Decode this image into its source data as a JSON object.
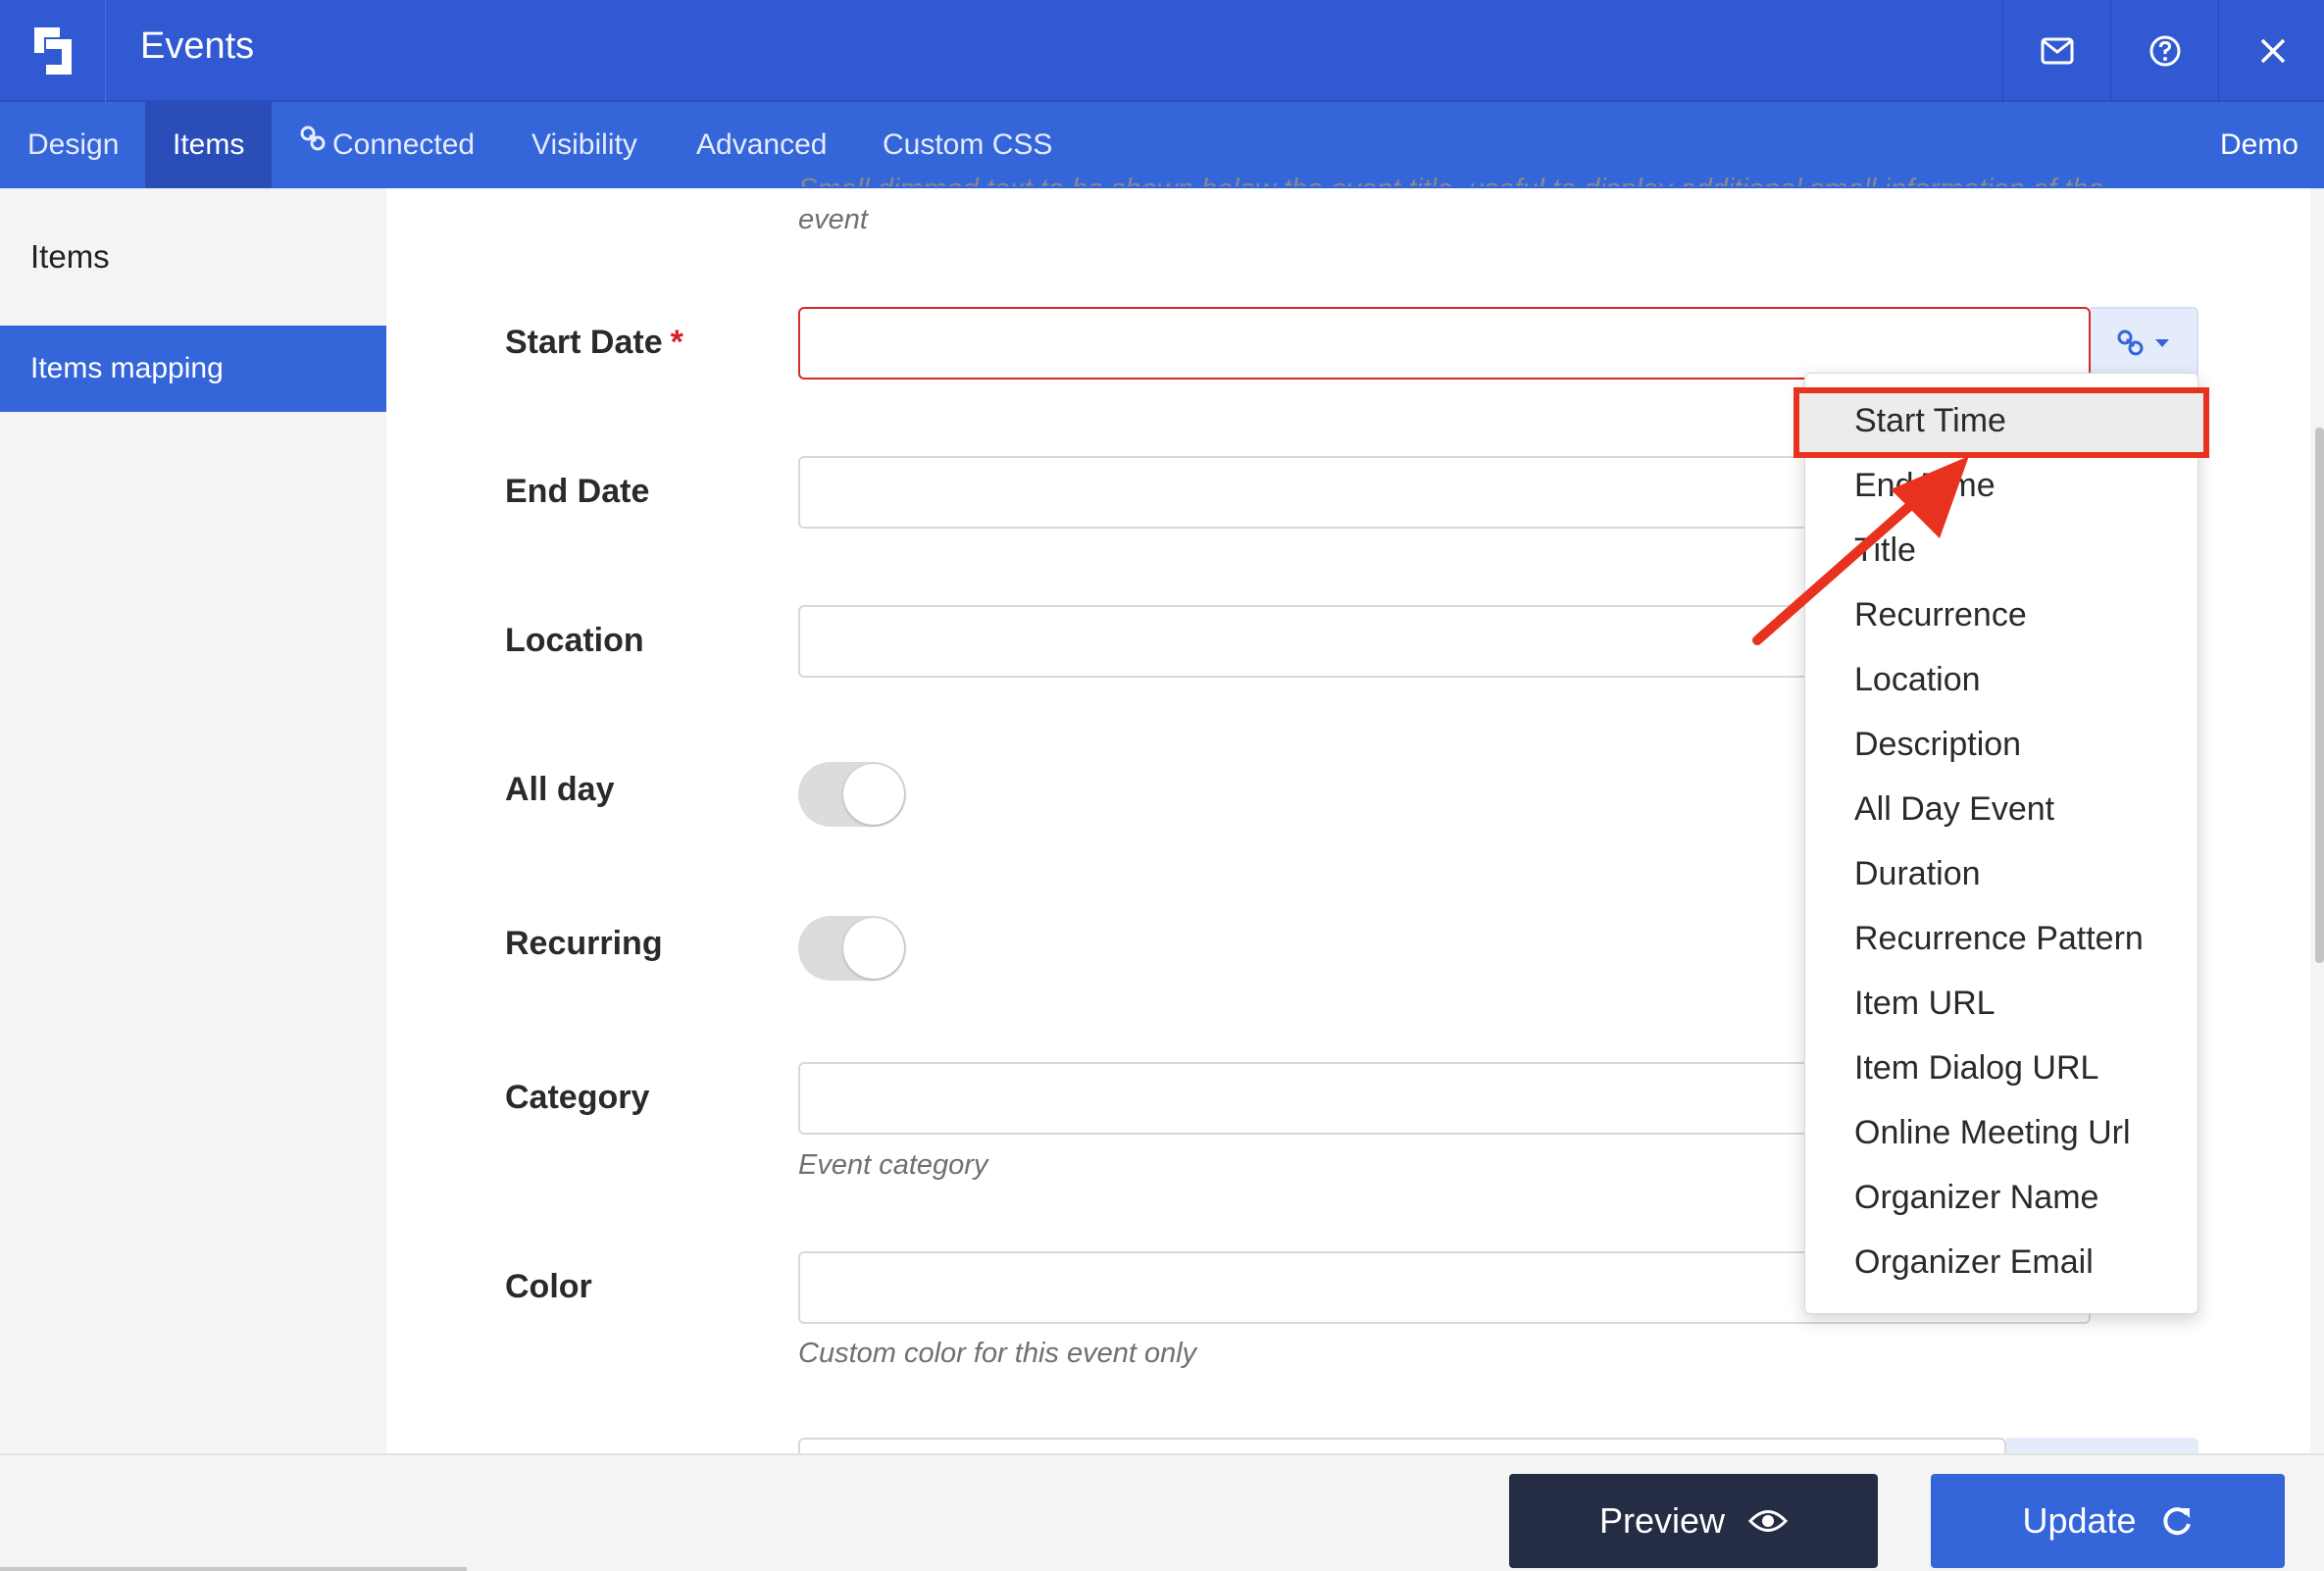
{
  "app": {
    "title": "Events"
  },
  "header": {
    "buttons": [
      {
        "name": "mail-icon"
      },
      {
        "name": "help-icon"
      },
      {
        "name": "close-icon"
      }
    ]
  },
  "tabs": [
    {
      "label": "Design",
      "active": false
    },
    {
      "label": "Items",
      "active": true
    },
    {
      "label": "Connected",
      "active": false,
      "icon": "link-icon"
    },
    {
      "label": "Visibility",
      "active": false
    },
    {
      "label": "Advanced",
      "active": false
    },
    {
      "label": "Custom CSS",
      "active": false
    }
  ],
  "demo_label": "Demo",
  "sidebar": {
    "items": [
      {
        "label": "Items",
        "active": false
      },
      {
        "label": "Items mapping",
        "active": true
      }
    ]
  },
  "form": {
    "top_hint": "event",
    "top_hint_cut": "Small dimmed text to be shown below the event title, useful to display additional small information of the",
    "fields": {
      "start_date": {
        "label": "Start Date",
        "required_mark": "*",
        "value": ""
      },
      "end_date": {
        "label": "End Date",
        "value": ""
      },
      "location": {
        "label": "Location",
        "value": ""
      },
      "all_day": {
        "label": "All day"
      },
      "recurring": {
        "label": "Recurring"
      },
      "category": {
        "label": "Category",
        "value": "",
        "hint": "Event category"
      },
      "color": {
        "label": "Color",
        "value": "",
        "hint": "Custom color for this event only"
      }
    }
  },
  "dropdown": {
    "selected": "Start Time",
    "items": [
      "Start Time",
      "End Time",
      "Title",
      "Recurrence",
      "Location",
      "Description",
      "All Day Event",
      "Duration",
      "Recurrence Pattern",
      "Item URL",
      "Item Dialog URL",
      "Online Meeting Url",
      "Organizer Name",
      "Organizer Email"
    ]
  },
  "footer": {
    "preview_label": "Preview",
    "update_label": "Update"
  },
  "colors": {
    "primary": "#3465d9",
    "header": "#3159d2",
    "error": "#d72b2b",
    "annotation": "#e8321f",
    "dark_button": "#252d44"
  }
}
